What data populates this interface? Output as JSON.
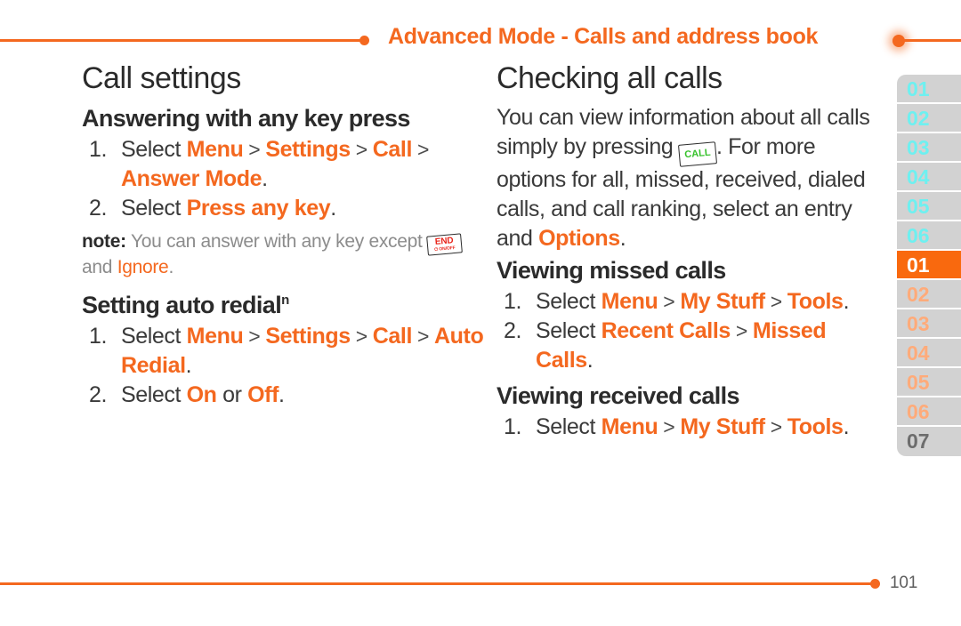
{
  "header": {
    "title": "Advanced Mode - Calls and address book",
    "accent_color": "#f4681f"
  },
  "left_column": {
    "page_title": "Call settings",
    "sections": [
      {
        "heading": "Answering with any key press",
        "superscript": "",
        "steps": [
          {
            "number": "1.",
            "parts": [
              {
                "t": "Select ",
                "style": "plain"
              },
              {
                "t": "Menu",
                "style": "orange"
              },
              {
                "t": " > ",
                "style": "gt"
              },
              {
                "t": "Settings",
                "style": "orange"
              },
              {
                "t": " > ",
                "style": "gt"
              },
              {
                "t": "Call",
                "style": "orange"
              },
              {
                "t": " > ",
                "style": "gt"
              },
              {
                "t": "Answer Mode",
                "style": "orange"
              },
              {
                "t": ".",
                "style": "plain"
              }
            ]
          },
          {
            "number": "2.",
            "parts": [
              {
                "t": "Select ",
                "style": "plain"
              },
              {
                "t": "Press any key",
                "style": "orange"
              },
              {
                "t": ".",
                "style": "plain"
              }
            ]
          }
        ],
        "note": {
          "label": "note:",
          "text_before": " You can answer with any key except ",
          "key_icon": "end-key-icon",
          "key_icon_line1": "END",
          "key_icon_line2": "⏻ ON/OFF",
          "text_middle": " and ",
          "link": "Ignore",
          "text_after": "."
        }
      },
      {
        "heading": "Setting auto redial",
        "superscript": "n",
        "steps": [
          {
            "number": "1.",
            "parts": [
              {
                "t": "Select ",
                "style": "plain"
              },
              {
                "t": "Menu",
                "style": "orange"
              },
              {
                "t": " > ",
                "style": "gt"
              },
              {
                "t": "Settings",
                "style": "orange"
              },
              {
                "t": " > ",
                "style": "gt"
              },
              {
                "t": "Call",
                "style": "orange"
              },
              {
                "t": " > ",
                "style": "gt"
              },
              {
                "t": "Auto Redial",
                "style": "orange"
              },
              {
                "t": ".",
                "style": "plain"
              }
            ]
          },
          {
            "number": "2.",
            "parts": [
              {
                "t": "Select ",
                "style": "plain"
              },
              {
                "t": "On",
                "style": "orange"
              },
              {
                "t": " or ",
                "style": "plain"
              },
              {
                "t": "Off",
                "style": "orange"
              },
              {
                "t": ".",
                "style": "plain"
              }
            ]
          }
        ]
      }
    ]
  },
  "right_column": {
    "page_title": "Checking all calls",
    "intro": {
      "text_before": "You can view information about all calls simply by pressing ",
      "key_icon": "call-key-icon",
      "key_icon_label": "CALL",
      "text_middle": ". For more options for all, missed, received, dialed calls, and call ranking, select an entry and ",
      "link": "Options",
      "text_after": "."
    },
    "sections": [
      {
        "heading": "Viewing missed calls",
        "steps": [
          {
            "number": "1.",
            "parts": [
              {
                "t": "Select ",
                "style": "plain"
              },
              {
                "t": "Menu",
                "style": "orange"
              },
              {
                "t": " > ",
                "style": "gt"
              },
              {
                "t": "My Stuff",
                "style": "orange"
              },
              {
                "t": " > ",
                "style": "gt"
              },
              {
                "t": "Tools",
                "style": "orange"
              },
              {
                "t": ".",
                "style": "plain"
              }
            ]
          },
          {
            "number": "2.",
            "parts": [
              {
                "t": "Select ",
                "style": "plain"
              },
              {
                "t": "Recent Calls",
                "style": "orange"
              },
              {
                "t": " > ",
                "style": "gt"
              },
              {
                "t": "Missed Calls",
                "style": "orange"
              },
              {
                "t": ".",
                "style": "plain"
              }
            ]
          }
        ]
      },
      {
        "heading": "Viewing received calls",
        "steps": [
          {
            "number": "1.",
            "parts": [
              {
                "t": "Select ",
                "style": "plain"
              },
              {
                "t": "Menu",
                "style": "orange"
              },
              {
                "t": " > ",
                "style": "gt"
              },
              {
                "t": "My Stuff",
                "style": "orange"
              },
              {
                "t": " > ",
                "style": "gt"
              },
              {
                "t": "Tools",
                "style": "orange"
              },
              {
                "t": ".",
                "style": "plain"
              }
            ]
          }
        ]
      }
    ]
  },
  "sidebar": {
    "tabs": [
      {
        "label": "01",
        "state": "cyan"
      },
      {
        "label": "02",
        "state": "cyan"
      },
      {
        "label": "03",
        "state": "cyan"
      },
      {
        "label": "04",
        "state": "cyan"
      },
      {
        "label": "05",
        "state": "cyan"
      },
      {
        "label": "06",
        "state": "cyan"
      },
      {
        "label": "01",
        "state": "active"
      },
      {
        "label": "02",
        "state": "peach"
      },
      {
        "label": "03",
        "state": "peach"
      },
      {
        "label": "04",
        "state": "peach"
      },
      {
        "label": "05",
        "state": "peach"
      },
      {
        "label": "06",
        "state": "peach"
      },
      {
        "label": "07",
        "state": "dark"
      }
    ],
    "active_color": "#f9690e"
  },
  "footer": {
    "page_number": "101"
  }
}
